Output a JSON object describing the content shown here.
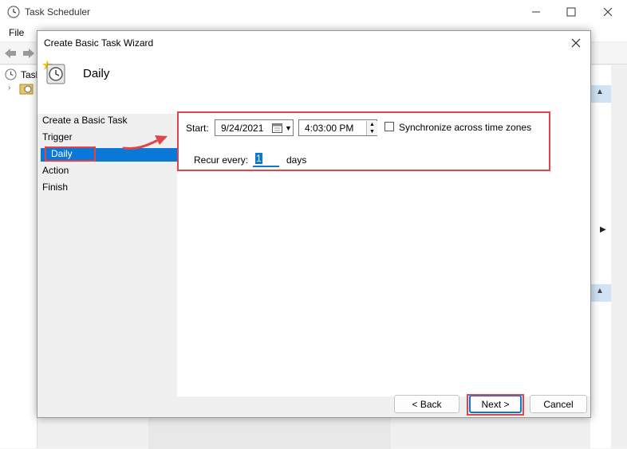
{
  "background_window": {
    "title": "Task Scheduler",
    "menu": [
      "File"
    ],
    "tree_item": "Task"
  },
  "dialog": {
    "title": "Create Basic Task Wizard",
    "header_title": "Daily",
    "steps": [
      {
        "label": "Create a Basic Task"
      },
      {
        "label": "Trigger"
      },
      {
        "label": "Daily",
        "selected": true
      },
      {
        "label": "Action"
      },
      {
        "label": "Finish"
      }
    ],
    "form": {
      "start_label": "Start:",
      "start_date": "9/24/2021",
      "start_time": "4:03:00 PM",
      "sync_label": "Synchronize across time zones",
      "sync_checked": false,
      "recur_label": "Recur every:",
      "recur_value": "1",
      "recur_unit": "days"
    },
    "buttons": {
      "back": "< Back",
      "next": "Next >",
      "cancel": "Cancel"
    }
  },
  "colors": {
    "accent": "#0a78d7",
    "highlight": "#e0454c"
  },
  "icons": [
    "clock-icon",
    "calendar-icon",
    "folder-clock-icon",
    "close-icon",
    "minimize-icon",
    "maximize-icon",
    "back-arrow-icon",
    "forward-arrow-icon"
  ]
}
